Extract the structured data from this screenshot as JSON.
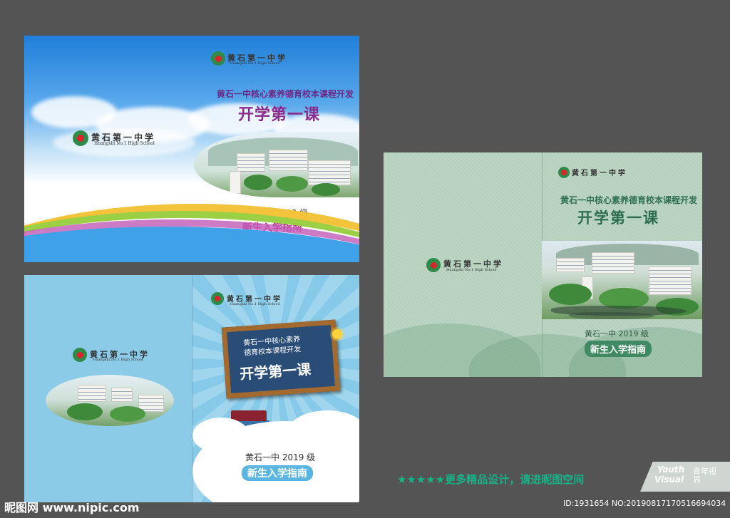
{
  "school": {
    "name_cn_calligraphy": "黄石第一中学",
    "name_en": "Huangshi No.1 High School"
  },
  "cover": {
    "subtitle": "黄石一中核心素养德育校本课程开发",
    "title": "开学第一课",
    "grade": "黄石一中 2019 级",
    "guide": "新生入学指南"
  },
  "board": {
    "line1": "黄石一中核心素养",
    "line2": "德育校本课程开发",
    "title": "开学第一课"
  },
  "promo": {
    "text": "★★★★★更多精品设计，请进昵图空间",
    "logo_en_1": "Youth",
    "logo_en_2": "Visual",
    "logo_cn": "青年视界"
  },
  "watermark": {
    "site": "昵图网 www.nipic.com",
    "id": "ID:1931654 NO:20190817170516694034"
  },
  "colors": {
    "background": "#545454",
    "sky_blue": "#1f7fd9",
    "title_purple": "#8b2a8f",
    "subtitle_purple": "#6a2a86",
    "guide_pink": "#c0288a",
    "green_title": "#2f6f4e",
    "promo_green": "#14b487"
  }
}
